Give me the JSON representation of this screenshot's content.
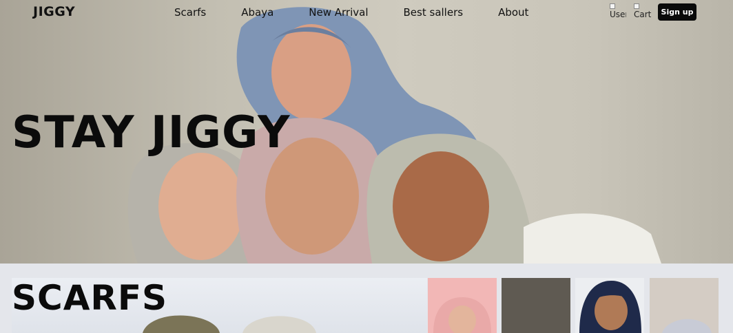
{
  "nav": {
    "logo": "JIGGY",
    "links": [
      "Scarfs",
      "Abaya",
      "New Arrival",
      "Best sallers",
      "About"
    ],
    "user_icon_alt": "User",
    "cart_icon_alt": "Cart",
    "signup_label": "Sign up"
  },
  "hero": {
    "title": "STAY JIGGY"
  },
  "scarfs": {
    "title": "SCARFS"
  },
  "colors": {
    "text": "#0b0b0b",
    "signup_bg": "#0a0a0a",
    "section_bg": "#e4e6eb",
    "thumb_pink": "#f2b7b6",
    "thumb_brown": "#5f5a52",
    "thumb_navy": "#1f2a4a",
    "thumb_beige": "#d4ccc4"
  }
}
